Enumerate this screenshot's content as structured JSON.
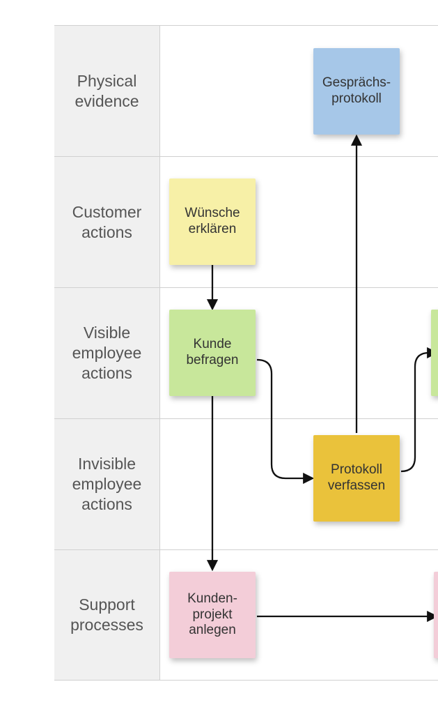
{
  "rows": [
    {
      "label": "Physical evidence"
    },
    {
      "label": "Customer actions"
    },
    {
      "label": "Visible employee actions"
    },
    {
      "label": "Invisible employee actions"
    },
    {
      "label": "Support processes"
    }
  ],
  "stickies": {
    "evidence_protocol": "Gesprächs-\nprotokoll",
    "customer_wishes": "Wünsche erklären",
    "visible_interview": "Kunde befragen",
    "invisible_protocol": "Protokoll verfassen",
    "support_project": "Kunden-\nprojekt anlegen"
  },
  "colors": {
    "blue": "#a6c7e8",
    "yellow": "#f7f0a7",
    "green": "#c8e79b",
    "amber": "#eac23b",
    "pink": "#f3cdd8"
  }
}
